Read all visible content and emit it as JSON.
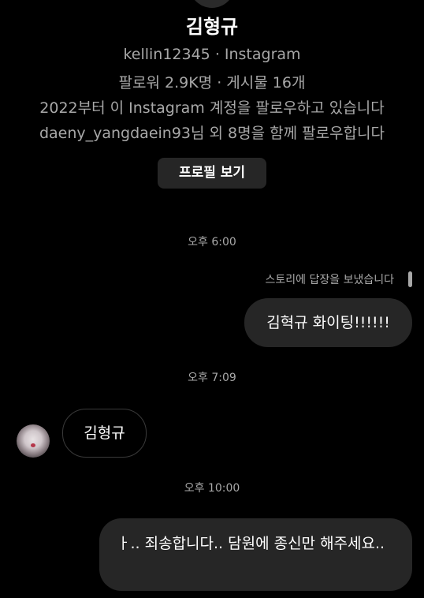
{
  "profile": {
    "name": "김형규",
    "handle_line": "kellin12345 · Instagram",
    "stats_line": "팔로워 2.9K명 · 게시물 16개",
    "since_line": "2022부터 이 Instagram 계정을 팔로우하고 있습니다",
    "mutual_line": "daeny_yangdaein93님 외 8명을 함께 팔로우합니다",
    "view_profile_label": "프로필 보기"
  },
  "messages": [
    {
      "type": "timestamp",
      "text": "오후 6:00"
    },
    {
      "type": "story_reply_note",
      "text": "스토리에 답장을 보냈습니다"
    },
    {
      "type": "outgoing",
      "text": "김혁규 화이팅!!!!!!"
    },
    {
      "type": "timestamp",
      "text": "오후 7:09"
    },
    {
      "type": "incoming",
      "text": "김형규"
    },
    {
      "type": "timestamp",
      "text": "오후 10:00"
    },
    {
      "type": "outgoing",
      "text": "ㅏ.. 죄송합니다.. 담원에 종신만 해주세요.."
    }
  ],
  "colors": {
    "background": "#000000",
    "primary_text": "#ffffff",
    "secondary_text": "#a8a8a8",
    "bubble_outgoing": "#262626",
    "button_bg": "#262626"
  }
}
